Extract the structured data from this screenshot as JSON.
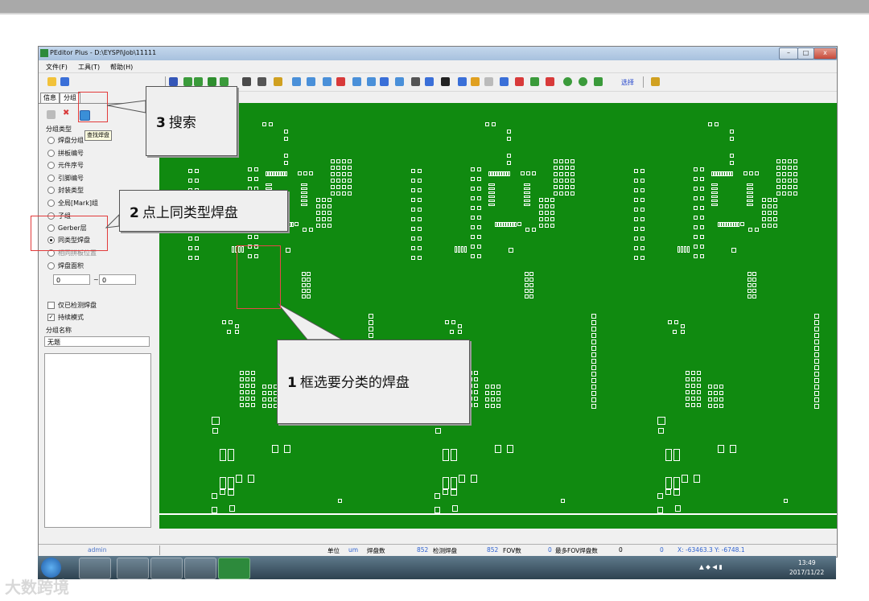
{
  "app": {
    "title": "PEditor Plus - D:\\EYSPI\\Job\\11111",
    "window_buttons": {
      "minimize": "–",
      "maximize": "□",
      "close": "x"
    }
  },
  "menu": [
    {
      "label": "文件(F)"
    },
    {
      "label": "工具(T)"
    },
    {
      "label": "帮助(H)"
    }
  ],
  "toolbar": {
    "select_label": "选择"
  },
  "left_panel": {
    "tabs": [
      {
        "label": "信息"
      },
      {
        "label": "分组"
      }
    ],
    "tooltip": "查找焊盘",
    "group_type_label": "分组类型",
    "radios": [
      {
        "label": "焊盘分组",
        "selected": false
      },
      {
        "label": "拼板编号",
        "selected": false
      },
      {
        "label": "元件序号",
        "selected": false
      },
      {
        "label": "引脚编号",
        "selected": false
      },
      {
        "label": "封装类型",
        "selected": false
      },
      {
        "label": "全局[Mark]组",
        "selected": false
      },
      {
        "label": "子组",
        "selected": false
      },
      {
        "label": "Gerber层",
        "selected": false
      },
      {
        "label": "同类型焊盘",
        "selected": true
      },
      {
        "label": "相同拼板位置",
        "selected": false
      },
      {
        "label": "焊盘面积",
        "selected": false
      }
    ],
    "area_min": "0",
    "area_sep": "~",
    "area_max": "0",
    "checkboxes": [
      {
        "label": "仅已检测焊盘",
        "checked": false
      },
      {
        "label": "持续模式",
        "checked": true
      }
    ],
    "group_name_label": "分组名称",
    "group_name_value": "无题"
  },
  "status": {
    "user": "admin",
    "unit_label": "单位",
    "unit_value": "um",
    "pad_count_label": "焊盘数",
    "pad_count": "852",
    "inspected_label": "检测焊盘",
    "inspected_count": "852",
    "fov_label": "FOV数",
    "fov_count": "0",
    "max_fov_label": "最多FOV焊盘数",
    "max_fov_count": "0",
    "zero_value": "0",
    "coords": "X: -63463.3  Y: -6748.1"
  },
  "taskbar": {
    "time": "13:49",
    "date": "2017/11/22"
  },
  "callouts": [
    {
      "num": "3",
      "text": "搜索"
    },
    {
      "num": "2",
      "text": "点上同类型焊盘"
    },
    {
      "num": "1",
      "text": "框选要分类的焊盘"
    }
  ],
  "watermark": "大数跨境",
  "colors": {
    "board": "#108a10",
    "highlight": "#e23b3b",
    "pads": "#ffffff"
  }
}
